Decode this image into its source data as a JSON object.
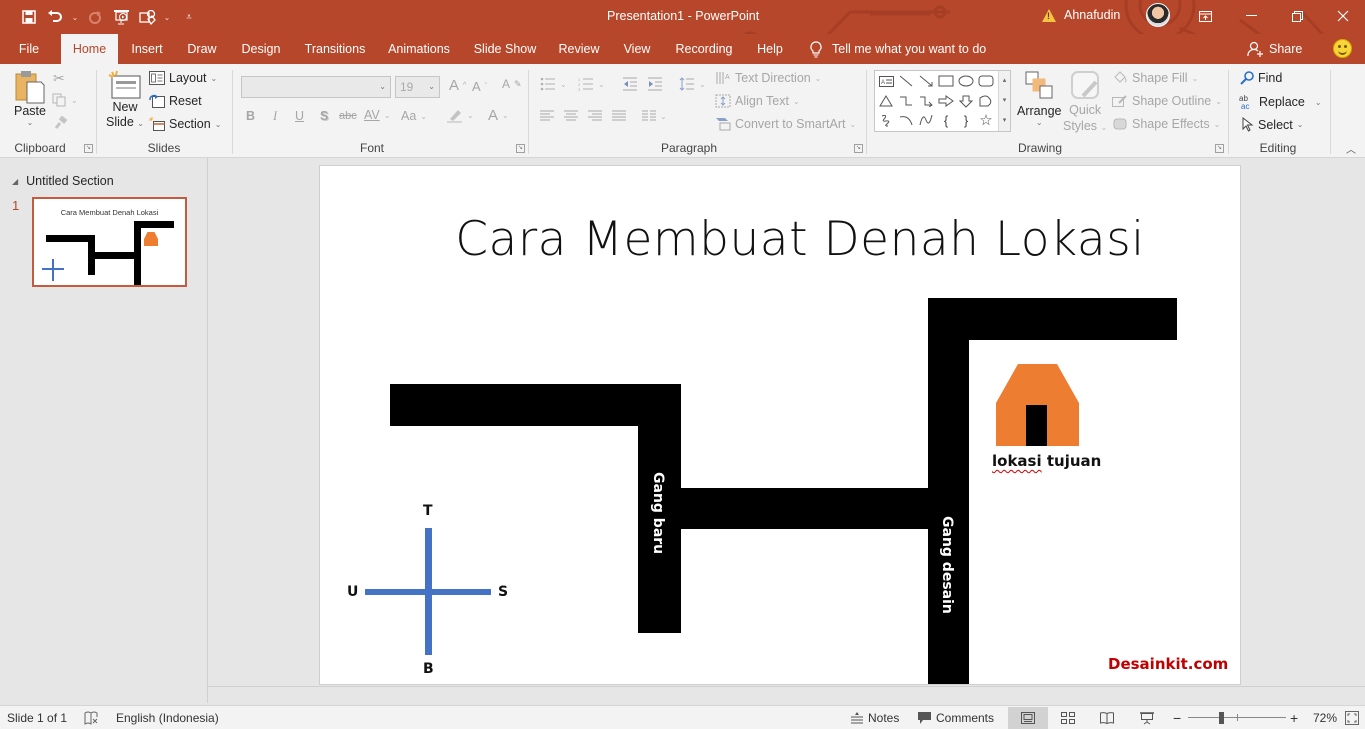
{
  "window": {
    "title": "Presentation1  -  PowerPoint",
    "user_name": "Ahnafudin",
    "accent_color": "#b7472a"
  },
  "quick_access": {
    "save": "save-icon",
    "undo": "undo-icon",
    "redo": "redo-icon",
    "from_beginning": "present-from-beginning-icon",
    "shapes": "shapes-icon",
    "customize": "customize-qat-icon"
  },
  "ribbon_tabs": [
    "File",
    "Home",
    "Insert",
    "Draw",
    "Design",
    "Transitions",
    "Animations",
    "Slide Show",
    "Review",
    "View",
    "Recording",
    "Help"
  ],
  "active_tab": "Home",
  "tell_me": "Tell me what you want to do",
  "share_label": "Share",
  "ribbon": {
    "clipboard": {
      "label": "Clipboard",
      "paste": "Paste"
    },
    "slides": {
      "label": "Slides",
      "new_slide_line1": "New",
      "new_slide_line2": "Slide",
      "layout": "Layout",
      "reset": "Reset",
      "section": "Section"
    },
    "font": {
      "label": "Font",
      "font_name": "",
      "font_size": "19",
      "bold": "B",
      "italic": "I",
      "underline": "U",
      "shadow": "S",
      "strikethrough": "abc",
      "spacing": "AV",
      "change_case": "Aa",
      "font_color": "A"
    },
    "paragraph": {
      "label": "Paragraph",
      "text_direction": "Text Direction",
      "align_text": "Align Text",
      "convert_smartart": "Convert to SmartArt"
    },
    "drawing": {
      "label": "Drawing",
      "arrange": "Arrange",
      "quick_styles_line1": "Quick",
      "quick_styles_line2": "Styles",
      "shape_fill": "Shape Fill",
      "shape_outline": "Shape Outline",
      "shape_effects": "Shape Effects"
    },
    "editing": {
      "label": "Editing",
      "find": "Find",
      "replace": "Replace",
      "select": "Select"
    }
  },
  "thumbnails": {
    "section_name": "Untitled Section",
    "slides": [
      {
        "number": "1",
        "title": "Cara Membuat Denah Lokasi"
      }
    ]
  },
  "slide": {
    "title": "Cara Membuat Denah Lokasi",
    "road_labels": {
      "left": "Gang baru",
      "right": "Gang desain"
    },
    "compass": {
      "north": "T",
      "south": "B",
      "west": "U",
      "east": "S",
      "color": "#4472c4"
    },
    "destination_label_misspelled": "lokasi",
    "destination_label_rest": " tujuan",
    "house_color": "#ed7d31",
    "watermark": "Desainkit.com",
    "watermark_color": "#c00000"
  },
  "status": {
    "slide_counter": "Slide 1 of 1",
    "language": "English (Indonesia)",
    "notes": "Notes",
    "comments": "Comments",
    "zoom": "72%"
  }
}
